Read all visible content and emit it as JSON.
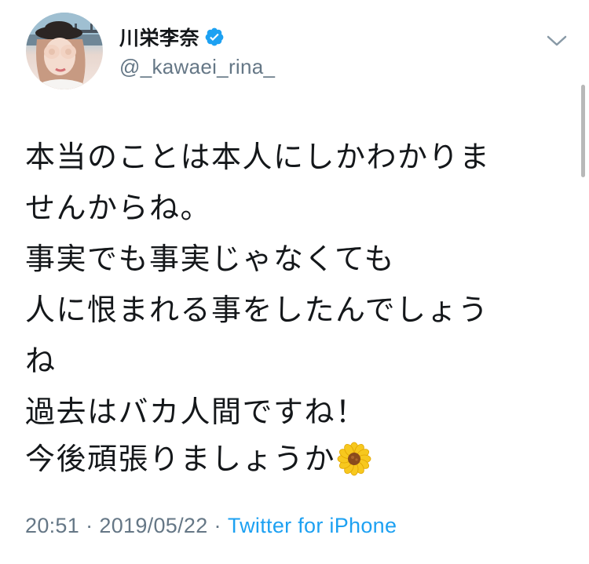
{
  "user": {
    "display_name": "川栄李奈",
    "handle": "@_kawaei_rina_",
    "verified": true
  },
  "tweet": {
    "text": "本当のことは本人にしかわかりま\nせんからね。\n事実でも事実じゃなくても\n人に恨まれる事をしたんでしょう\nね\n過去はバカ人間ですね！",
    "last_line": "今後頑張りましょうか",
    "emoji": "sunflower-icon"
  },
  "meta": {
    "time": "20:51",
    "separator": "·",
    "date": "2019/05/22",
    "source": "Twitter for iPhone"
  },
  "colors": {
    "text": "#14171a",
    "secondary": "#657786",
    "link": "#1da1f2",
    "verified": "#1da1f2"
  }
}
